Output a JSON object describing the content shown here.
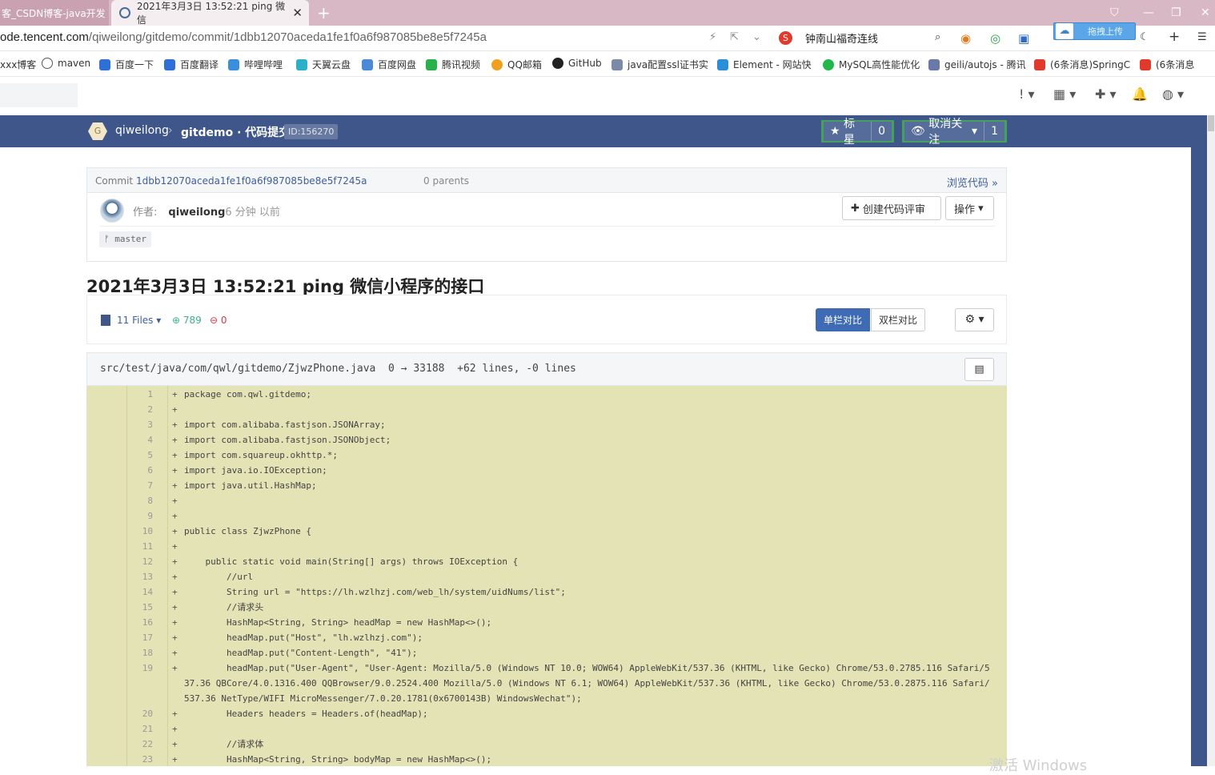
{
  "browser": {
    "tab1": "客_CSDN博客-java开发",
    "tab2": "2021年3月3日 13:52:21 ping 微信",
    "url_host": "ode.tencent.com",
    "url_path": "/qiweilong/gitdemo/commit/1dbb12070aceda1fe1f0a6f987085be8e5f7245a",
    "search_text": "钟南山福奇连线",
    "upload_label": "拖拽上传"
  },
  "bookmarks": [
    "xxx博客",
    "maven",
    "百度一下",
    "百度翻译",
    "哔哩哔哩",
    "天翼云盘",
    "百度网盘",
    "腾讯视频",
    "QQ邮箱",
    "GitHub",
    "java配置ssl证书实",
    "Element - 网站快",
    "MySQL高性能优化",
    "geili/autojs - 腾讯",
    "(6条消息)SpringC",
    "(6条消息"
  ],
  "header": {
    "logo_letter": "G",
    "user": "qiweilong",
    "project": "gitdemo · 代码提交",
    "id": "ID:156270",
    "star_label": "标星",
    "star_count": "0",
    "watch_label": "取消关注",
    "watch_count": "1"
  },
  "commit": {
    "label": "Commit",
    "hash": "1dbb12070aceda1fe1f0a6f987085be8e5f7245a",
    "parents": "0 parents",
    "browse": "浏览代码",
    "author_prefix": "作者:",
    "author": "qiweilong",
    "time": "6 分钟 以前",
    "review_button": "创建代码评审",
    "ops_button": "操作",
    "branch": "master",
    "title": "2021年3月3日 13:52:21 ping 微信小程序的接口"
  },
  "files_bar": {
    "files": "11 Files",
    "added": "789",
    "removed": "0",
    "inline_view": "单栏对比",
    "split_view": "双栏对比"
  },
  "file": {
    "path": "src/test/java/com/qwl/gitdemo/ZjwzPhone.java",
    "sizes": "0 → 33188",
    "stats": "+62 lines, -0 lines"
  },
  "code_lines": [
    {
      "no": "1",
      "text": "package com.qwl.gitdemo;"
    },
    {
      "no": "2",
      "text": ""
    },
    {
      "no": "3",
      "text": "import com.alibaba.fastjson.JSONArray;"
    },
    {
      "no": "4",
      "text": "import com.alibaba.fastjson.JSONObject;"
    },
    {
      "no": "5",
      "text": "import com.squareup.okhttp.*;"
    },
    {
      "no": "6",
      "text": "import java.io.IOException;"
    },
    {
      "no": "7",
      "text": "import java.util.HashMap;"
    },
    {
      "no": "8",
      "text": ""
    },
    {
      "no": "9",
      "text": ""
    },
    {
      "no": "10",
      "text": "public class ZjwzPhone {"
    },
    {
      "no": "11",
      "text": ""
    },
    {
      "no": "12",
      "text": "    public static void main(String[] args) throws IOException {"
    },
    {
      "no": "13",
      "text": "        //url"
    },
    {
      "no": "14",
      "text": "        String url = \"https://lh.wzlhzj.com/web_lh/system/uidNums/list\";"
    },
    {
      "no": "15",
      "text": "        //请求头"
    },
    {
      "no": "16",
      "text": "        HashMap<String, String> headMap = new HashMap<>();"
    },
    {
      "no": "17",
      "text": "        headMap.put(\"Host\", \"lh.wzlhzj.com\");"
    },
    {
      "no": "18",
      "text": "        headMap.put(\"Content-Length\", \"41\");"
    },
    {
      "no": "19",
      "text": "        headMap.put(\"User-Agent\", \"User-Agent: Mozilla/5.0 (Windows NT 10.0; WOW64) AppleWebKit/537.36 (KHTML, like Gecko) Chrome/53.0.2785.116 Safari/537.36 QBCore/4.0.1316.400 QQBrowser/9.0.2524.400 Mozilla/5.0 (Windows NT 6.1; WOW64) AppleWebKit/537.36 (KHTML, like Gecko) Chrome/53.0.2875.116 Safari/537.36 NetType/WIFI MicroMessenger/7.0.20.1781(0x6700143B) WindowsWechat\");"
    },
    {
      "no": "20",
      "text": "        Headers headers = Headers.of(headMap);"
    },
    {
      "no": "21",
      "text": ""
    },
    {
      "no": "22",
      "text": "        //请求体"
    },
    {
      "no": "23",
      "text": "        HashMap<String, String> bodyMap = new HashMap<>();"
    }
  ],
  "watermark": "激活 Windows"
}
